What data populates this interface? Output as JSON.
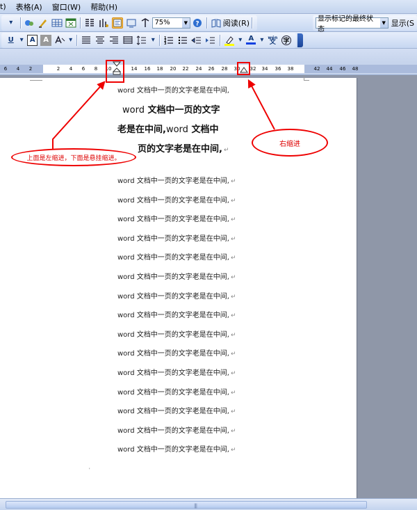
{
  "menu": [
    "t)",
    "表格(A)",
    "窗口(W)",
    "帮助(H)"
  ],
  "toolbar1": {
    "zoom": "75%",
    "read_label": "阅读(R)",
    "markup_state": "显示标记的最终状态",
    "show_label": "显示(S"
  },
  "toolbar2": {
    "underline": "U",
    "font_color_letter": "A",
    "phonetic": "wén"
  },
  "ruler": {
    "labels": [
      "6",
      "4",
      "2",
      "2",
      "4",
      "6",
      "8",
      "10",
      "14",
      "16",
      "18",
      "20",
      "22",
      "24",
      "26",
      "28",
      "30",
      "32",
      "34",
      "36",
      "38",
      "42",
      "44",
      "46",
      "48"
    ]
  },
  "document": {
    "line_text": "word 文档中一页的文字老是在中间,",
    "big_line_1": "文档中一页的文字",
    "big_line_1_latin": "word",
    "big_line_2_a": "老是在中间,",
    "big_line_2_latin": "word",
    "big_line_2_b": "文档中",
    "big_line_3": "页的文字老是在中间,",
    "pilcrow": "↵"
  },
  "annotations": {
    "left_note": "上面是左缩进，下面是悬挂缩进。",
    "right_note": "右缩进"
  },
  "colors": {
    "annotation_red": "#e00000",
    "toolbar_blue": "#c6d7f1"
  }
}
